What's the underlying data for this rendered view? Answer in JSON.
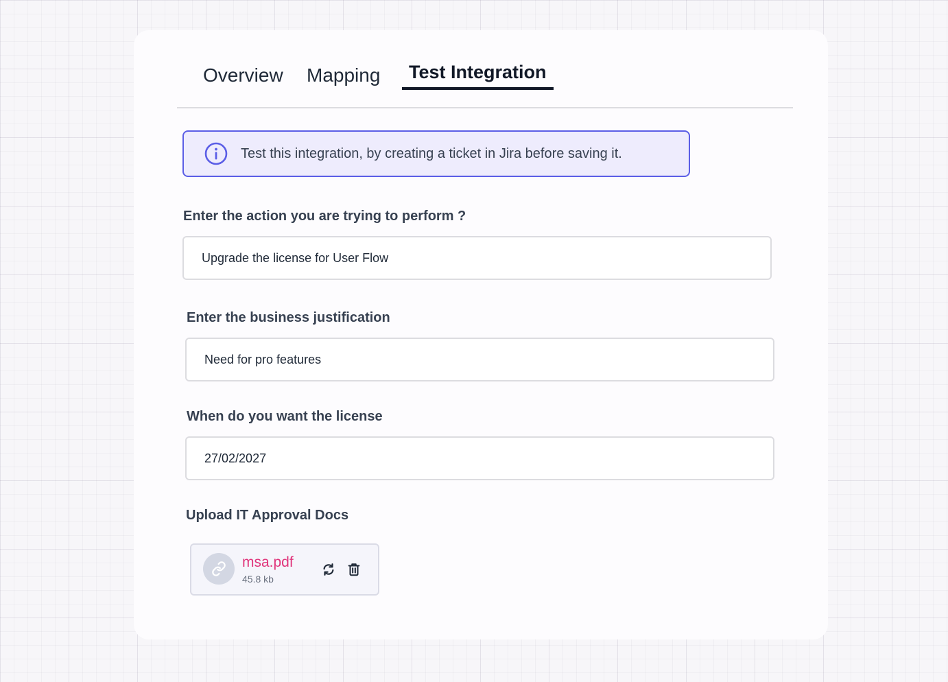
{
  "tabs": [
    {
      "label": "Overview",
      "active": false
    },
    {
      "label": "Mapping",
      "active": false
    },
    {
      "label": "Test Integration",
      "active": true
    }
  ],
  "banner": {
    "icon": "info-icon",
    "text": "Test this integration, by creating a ticket in Jira before saving it.",
    "accent_color": "#5b5ee6"
  },
  "form": {
    "action": {
      "label": "Enter the action you are trying to perform ?",
      "value": "Upgrade the license for User Flow"
    },
    "justification": {
      "label": "Enter the business justification",
      "value": "Need for pro features"
    },
    "date": {
      "label": "When do you want the license",
      "value": "27/02/2027"
    },
    "upload": {
      "label": "Upload IT Approval Docs",
      "file": {
        "name": "msa.pdf",
        "size": "45.8 kb",
        "icon": "link-icon",
        "name_color": "#e0357b"
      },
      "actions": [
        "refresh-icon",
        "trash-icon"
      ]
    }
  }
}
